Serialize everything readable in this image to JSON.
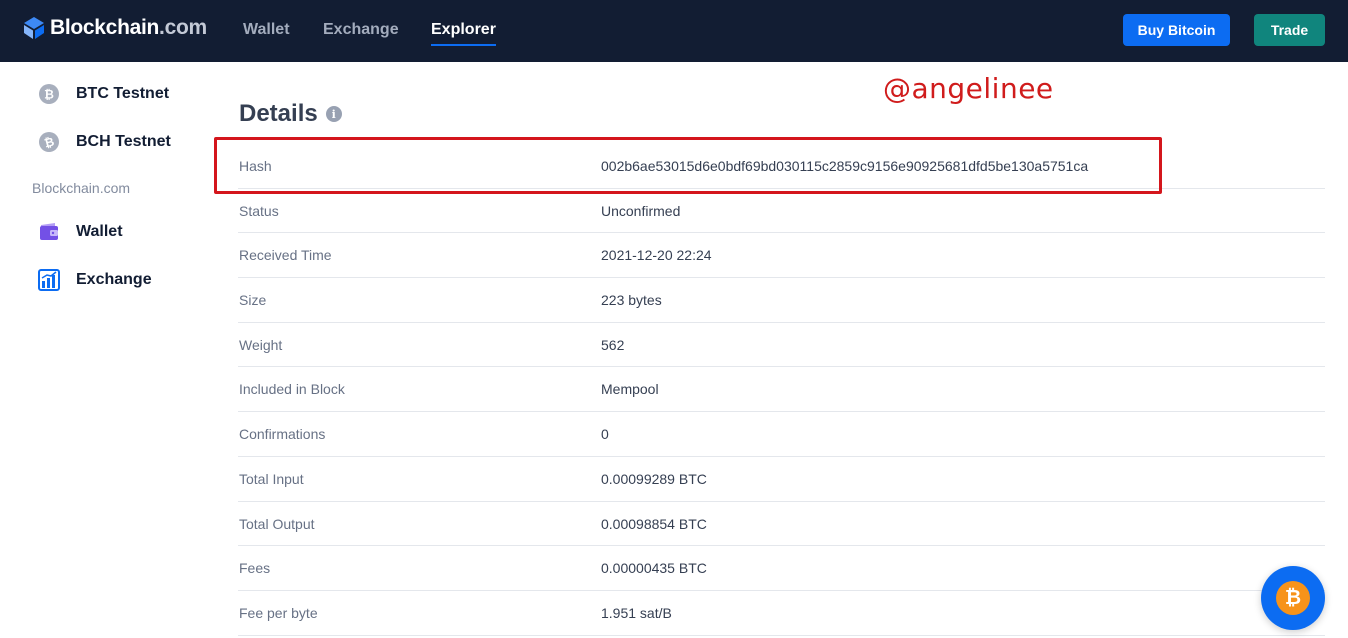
{
  "header": {
    "brand_name": "Blockchain",
    "brand_suffix": ".com",
    "nav": [
      {
        "label": "Wallet",
        "active": false
      },
      {
        "label": "Exchange",
        "active": false
      },
      {
        "label": "Explorer",
        "active": true
      }
    ],
    "buy_label": "Buy Bitcoin",
    "trade_label": "Trade"
  },
  "sidebar": {
    "items": [
      {
        "label": "BTC Testnet",
        "icon": "bitcoin-icon"
      },
      {
        "label": "BCH Testnet",
        "icon": "bitcoin-cash-icon"
      }
    ],
    "section_label": "Blockchain.com",
    "links": [
      {
        "label": "Wallet",
        "icon": "wallet-icon"
      },
      {
        "label": "Exchange",
        "icon": "exchange-chart-icon"
      }
    ]
  },
  "main": {
    "title": "Details",
    "info_icon": "i",
    "watermark": "@angelinee",
    "rows": [
      {
        "key": "Hash",
        "value": "002b6ae53015d6e0bdf69bd030115c2859c9156e90925681dfd5be130a5751ca"
      },
      {
        "key": "Status",
        "value": "Unconfirmed"
      },
      {
        "key": "Received Time",
        "value": "2021-12-20 22:24"
      },
      {
        "key": "Size",
        "value": "223 bytes"
      },
      {
        "key": "Weight",
        "value": "562"
      },
      {
        "key": "Included in Block",
        "value": "Mempool"
      },
      {
        "key": "Confirmations",
        "value": "0"
      },
      {
        "key": "Total Input",
        "value": "0.00099289 BTC"
      },
      {
        "key": "Total Output",
        "value": "0.00098854 BTC"
      },
      {
        "key": "Fees",
        "value": "0.00000435 BTC"
      },
      {
        "key": "Fee per byte",
        "value": "1.951 sat/B"
      }
    ]
  },
  "fab": {
    "symbol": "₿",
    "icon": "bitcoin-icon"
  },
  "colors": {
    "header_bg": "#121d33",
    "primary_blue": "#0c6cf2",
    "trade_teal": "#10857d",
    "highlight_red": "#d4161c",
    "bitcoin_orange": "#f7931a"
  }
}
